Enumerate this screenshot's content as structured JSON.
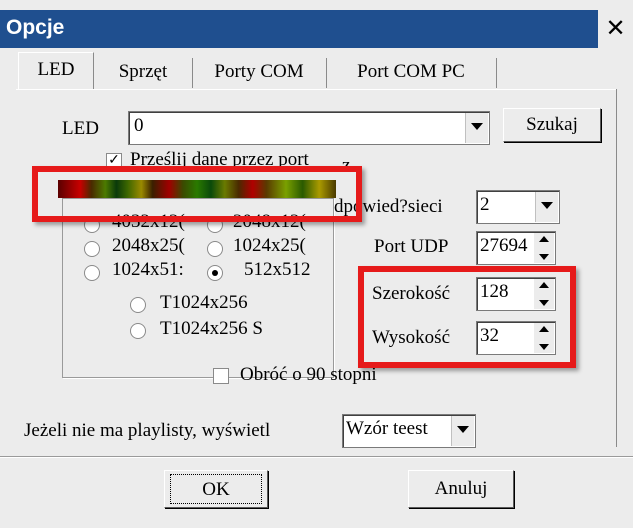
{
  "window": {
    "title": "Opcje",
    "close_glyph": "✕"
  },
  "tabs": [
    "LED",
    "Sprzęt",
    "Porty COM",
    "Port COM PC"
  ],
  "led_row": {
    "label": "LED",
    "value": "0",
    "search_button": "Szukaj"
  },
  "send_checkbox": {
    "label": "Prześlij dane przez port",
    "suffix": "z",
    "checked": true
  },
  "resolutions": {
    "row1": [
      "4032x12(",
      "2048x12("
    ],
    "row2": [
      "2048x25(",
      "1024x25("
    ],
    "row3": [
      "1024x51:",
      "512x512"
    ],
    "row4": "T1024x256",
    "row5": "T1024x256 S",
    "selected": "512x512"
  },
  "network": {
    "label": "dpowied?sieci",
    "value": "2"
  },
  "udp": {
    "label": "Port UDP",
    "value": "27694"
  },
  "width": {
    "label": "Szerokość",
    "value": "128"
  },
  "height": {
    "label": "Wysokość",
    "value": "32"
  },
  "rotate_checkbox": {
    "label": "Obróć o 90 stopni",
    "checked": false
  },
  "playlist": {
    "label": "Jeżeli nie ma playlisty, wyświetl",
    "value": "Wzór teest"
  },
  "buttons": {
    "ok": "OK",
    "cancel": "Anuluj"
  },
  "colors": {
    "title_bar": "#1f4f8f",
    "highlight": "#e61a1a",
    "dialog_bg": "#ececec"
  }
}
